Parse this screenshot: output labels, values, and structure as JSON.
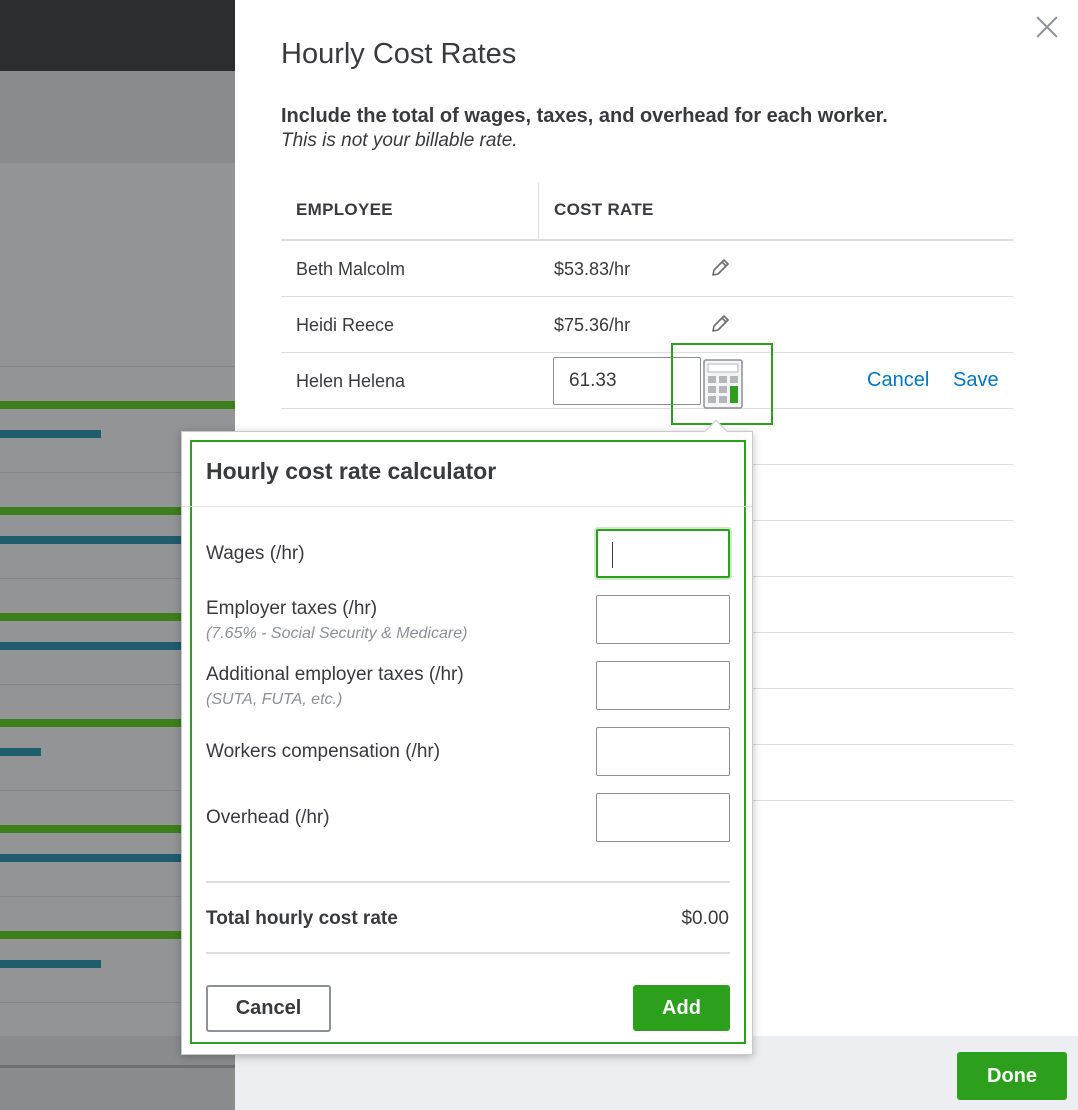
{
  "panel": {
    "title": "Hourly Cost Rates",
    "lead": "Include the total of wages, taxes, and overhead for each worker.",
    "sublead": "This is not your billable rate.",
    "columns": {
      "employee": "EMPLOYEE",
      "cost_rate": "COST RATE"
    },
    "rows": [
      {
        "name": "Beth Malcolm",
        "rate": "$53.83/hr"
      },
      {
        "name": "Heidi Reece",
        "rate": "$75.36/hr"
      }
    ],
    "editing_row": {
      "name": "Helen Helena",
      "value": "61.33",
      "cancel_label": "Cancel",
      "save_label": "Save"
    },
    "done_label": "Done"
  },
  "calculator": {
    "title": "Hourly cost rate calculator",
    "fields": [
      {
        "label": "Wages (/hr)",
        "hint": ""
      },
      {
        "label": "Employer taxes (/hr)",
        "hint": "(7.65% - Social Security & Medicare)"
      },
      {
        "label": "Additional employer taxes (/hr)",
        "hint": "(SUTA, FUTA, etc.)"
      },
      {
        "label": "Workers compensation (/hr)",
        "hint": ""
      },
      {
        "label": "Overhead (/hr)",
        "hint": ""
      }
    ],
    "total_label": "Total hourly cost rate",
    "total_value": "$0.00",
    "cancel_label": "Cancel",
    "add_label": "Add"
  },
  "colors": {
    "accent": "#2ca01c",
    "link": "#0077c5",
    "text": "#393a3d"
  },
  "icons": {
    "close": "close-icon",
    "edit": "pencil-icon",
    "calculator": "calculator-icon"
  }
}
